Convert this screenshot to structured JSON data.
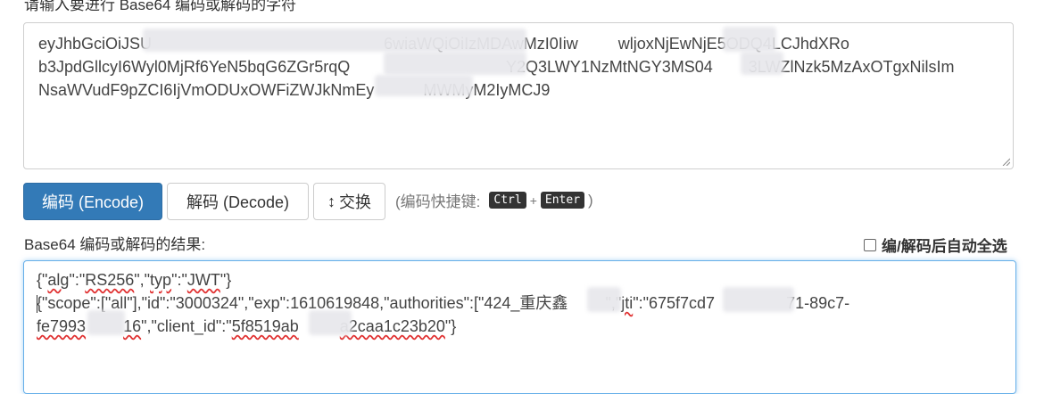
{
  "input": {
    "label": "请输入要进行 Base64 编码或解码的字符",
    "lines": [
      "eyJhbGciOiJSU                                                    6wiaWQiOiIzMDAwMzI0Iiw         wljoxNjEwNjE5ODQ4LCJhdXRo",
      "b3JpdGllcyI6Wyl0MjRf6YeN5bqG6ZGr5rqQ                                   Y2Q3LWY1NzMtNGY3MS04        3LWZlNzk5MzAxOTgxNilsIm",
      "NsaWVudF9pZCI6IjVmODUxOWFiZWJkNmEy           MWMyM2IyMCJ9"
    ]
  },
  "buttons": {
    "encode": "编码 (Encode)",
    "decode": "解码 (Decode)",
    "swap_icon": "↕",
    "swap": "交换"
  },
  "hint": {
    "prefix": "(编码快捷键:",
    "key1": "Ctrl",
    "plus": "+",
    "key2": "Enter",
    "suffix": ")"
  },
  "result": {
    "label": "Base64 编码或解码的结果:",
    "auto_select": "编/解码后自动全选",
    "auto_select_checked": false,
    "line1": {
      "t1": "{\"",
      "alg": "alg",
      "t2": "\":\"",
      "rs": "RS256",
      "t3": "\",\"",
      "typ": "typ",
      "t4": "\":\"",
      "jwt": "JWT",
      "t5": "\"}"
    },
    "line2": "{\"scope\":[\"all\"],\"id\":\"3000324\",\"exp\":1610619848,\"authorities\":[\"424_重庆鑫",
    "line2b": "\",\"",
    "jti": "jti",
    "line2c": "\":\"675f7cd7",
    "line2d": "71-89c7-",
    "line3a": "fe7993",
    "line3b": "16",
    "line3c": "\",\"client_id\":\"",
    "line3d": "5f8519ab",
    "line3e": "a2caa1c23b20",
    "line3f": "\"}"
  }
}
